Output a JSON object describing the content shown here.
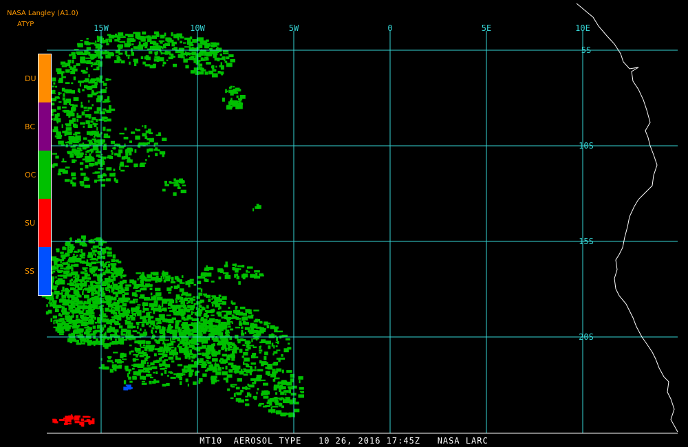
{
  "header": {
    "source": "NASA Langley (A1.0)",
    "product": "ATYP"
  },
  "legend": [
    {
      "label": "DU",
      "color": "#ff8c00"
    },
    {
      "label": "BC",
      "color": "#800080"
    },
    {
      "label": "OC",
      "color": "#00c000"
    },
    {
      "label": "SU",
      "color": "#ff0000"
    },
    {
      "label": "SS",
      "color": "#0050ff"
    }
  ],
  "grid": {
    "longitudes": [
      {
        "label": "15W",
        "lon": -15
      },
      {
        "label": "10W",
        "lon": -10
      },
      {
        "label": "5W",
        "lon": -5
      },
      {
        "label": "0",
        "lon": 0
      },
      {
        "label": "5E",
        "lon": 5
      },
      {
        "label": "10E",
        "lon": 10
      }
    ],
    "latitudes": [
      {
        "label": "5S",
        "lat": -5
      },
      {
        "label": "10S",
        "lat": -10
      },
      {
        "label": "15S",
        "lat": -15
      },
      {
        "label": "20S",
        "lat": -20
      }
    ],
    "line_color": "#36d6d6"
  },
  "footer": {
    "text": "MT10  AEROSOL TYPE   10 26, 2016 17:45Z   NASA LARC"
  },
  "colors": {
    "background": "#000000",
    "coastline": "#ffffff",
    "dominant_aerosol": "#00c000"
  }
}
